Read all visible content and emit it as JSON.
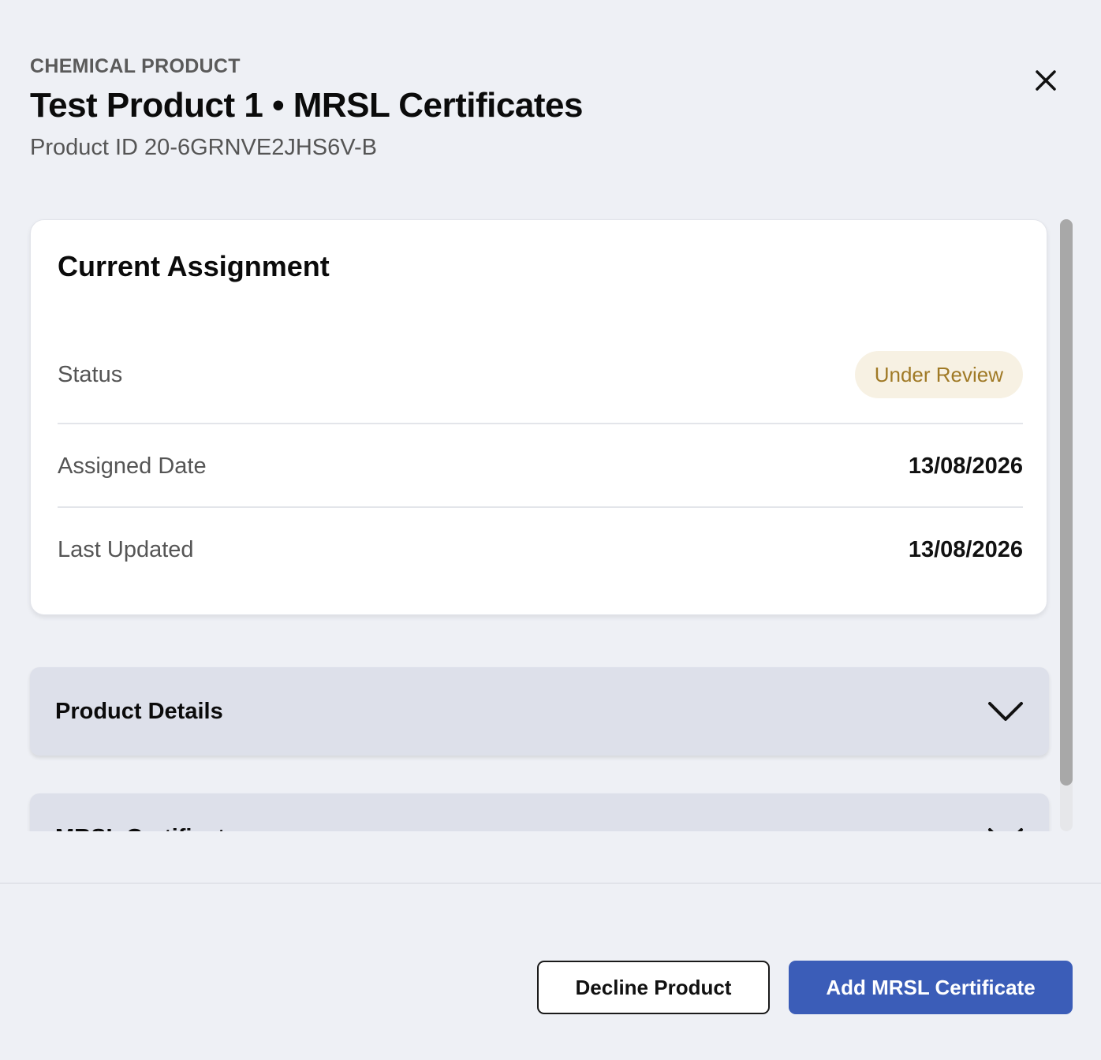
{
  "header": {
    "eyebrow": "CHEMICAL PRODUCT",
    "title": "Test Product 1 • MRSL Certificates",
    "subtitle": "Product ID 20-6GRNVE2JHS6V-B",
    "close_icon": "close-icon"
  },
  "assignment_card": {
    "title": "Current Assignment",
    "status_label": "Status",
    "status_value": "Under Review",
    "assigned_date_label": "Assigned Date",
    "assigned_date_value": "13/08/2026",
    "last_updated_label": "Last Updated",
    "last_updated_value": "13/08/2026"
  },
  "sections": [
    {
      "label": "Product Details",
      "icon": "chevron-down-icon"
    },
    {
      "label": "MRSL Certificates",
      "icon": "chevron-down-icon"
    }
  ],
  "footer": {
    "decline_label": "Decline Product",
    "add_label": "Add MRSL Certificate"
  },
  "colors": {
    "background": "#eef0f5",
    "primary": "#3b5db8",
    "badge_bg": "#f7f1e3",
    "badge_text": "#a07a26",
    "accordion_bg": "#dde0ea"
  }
}
